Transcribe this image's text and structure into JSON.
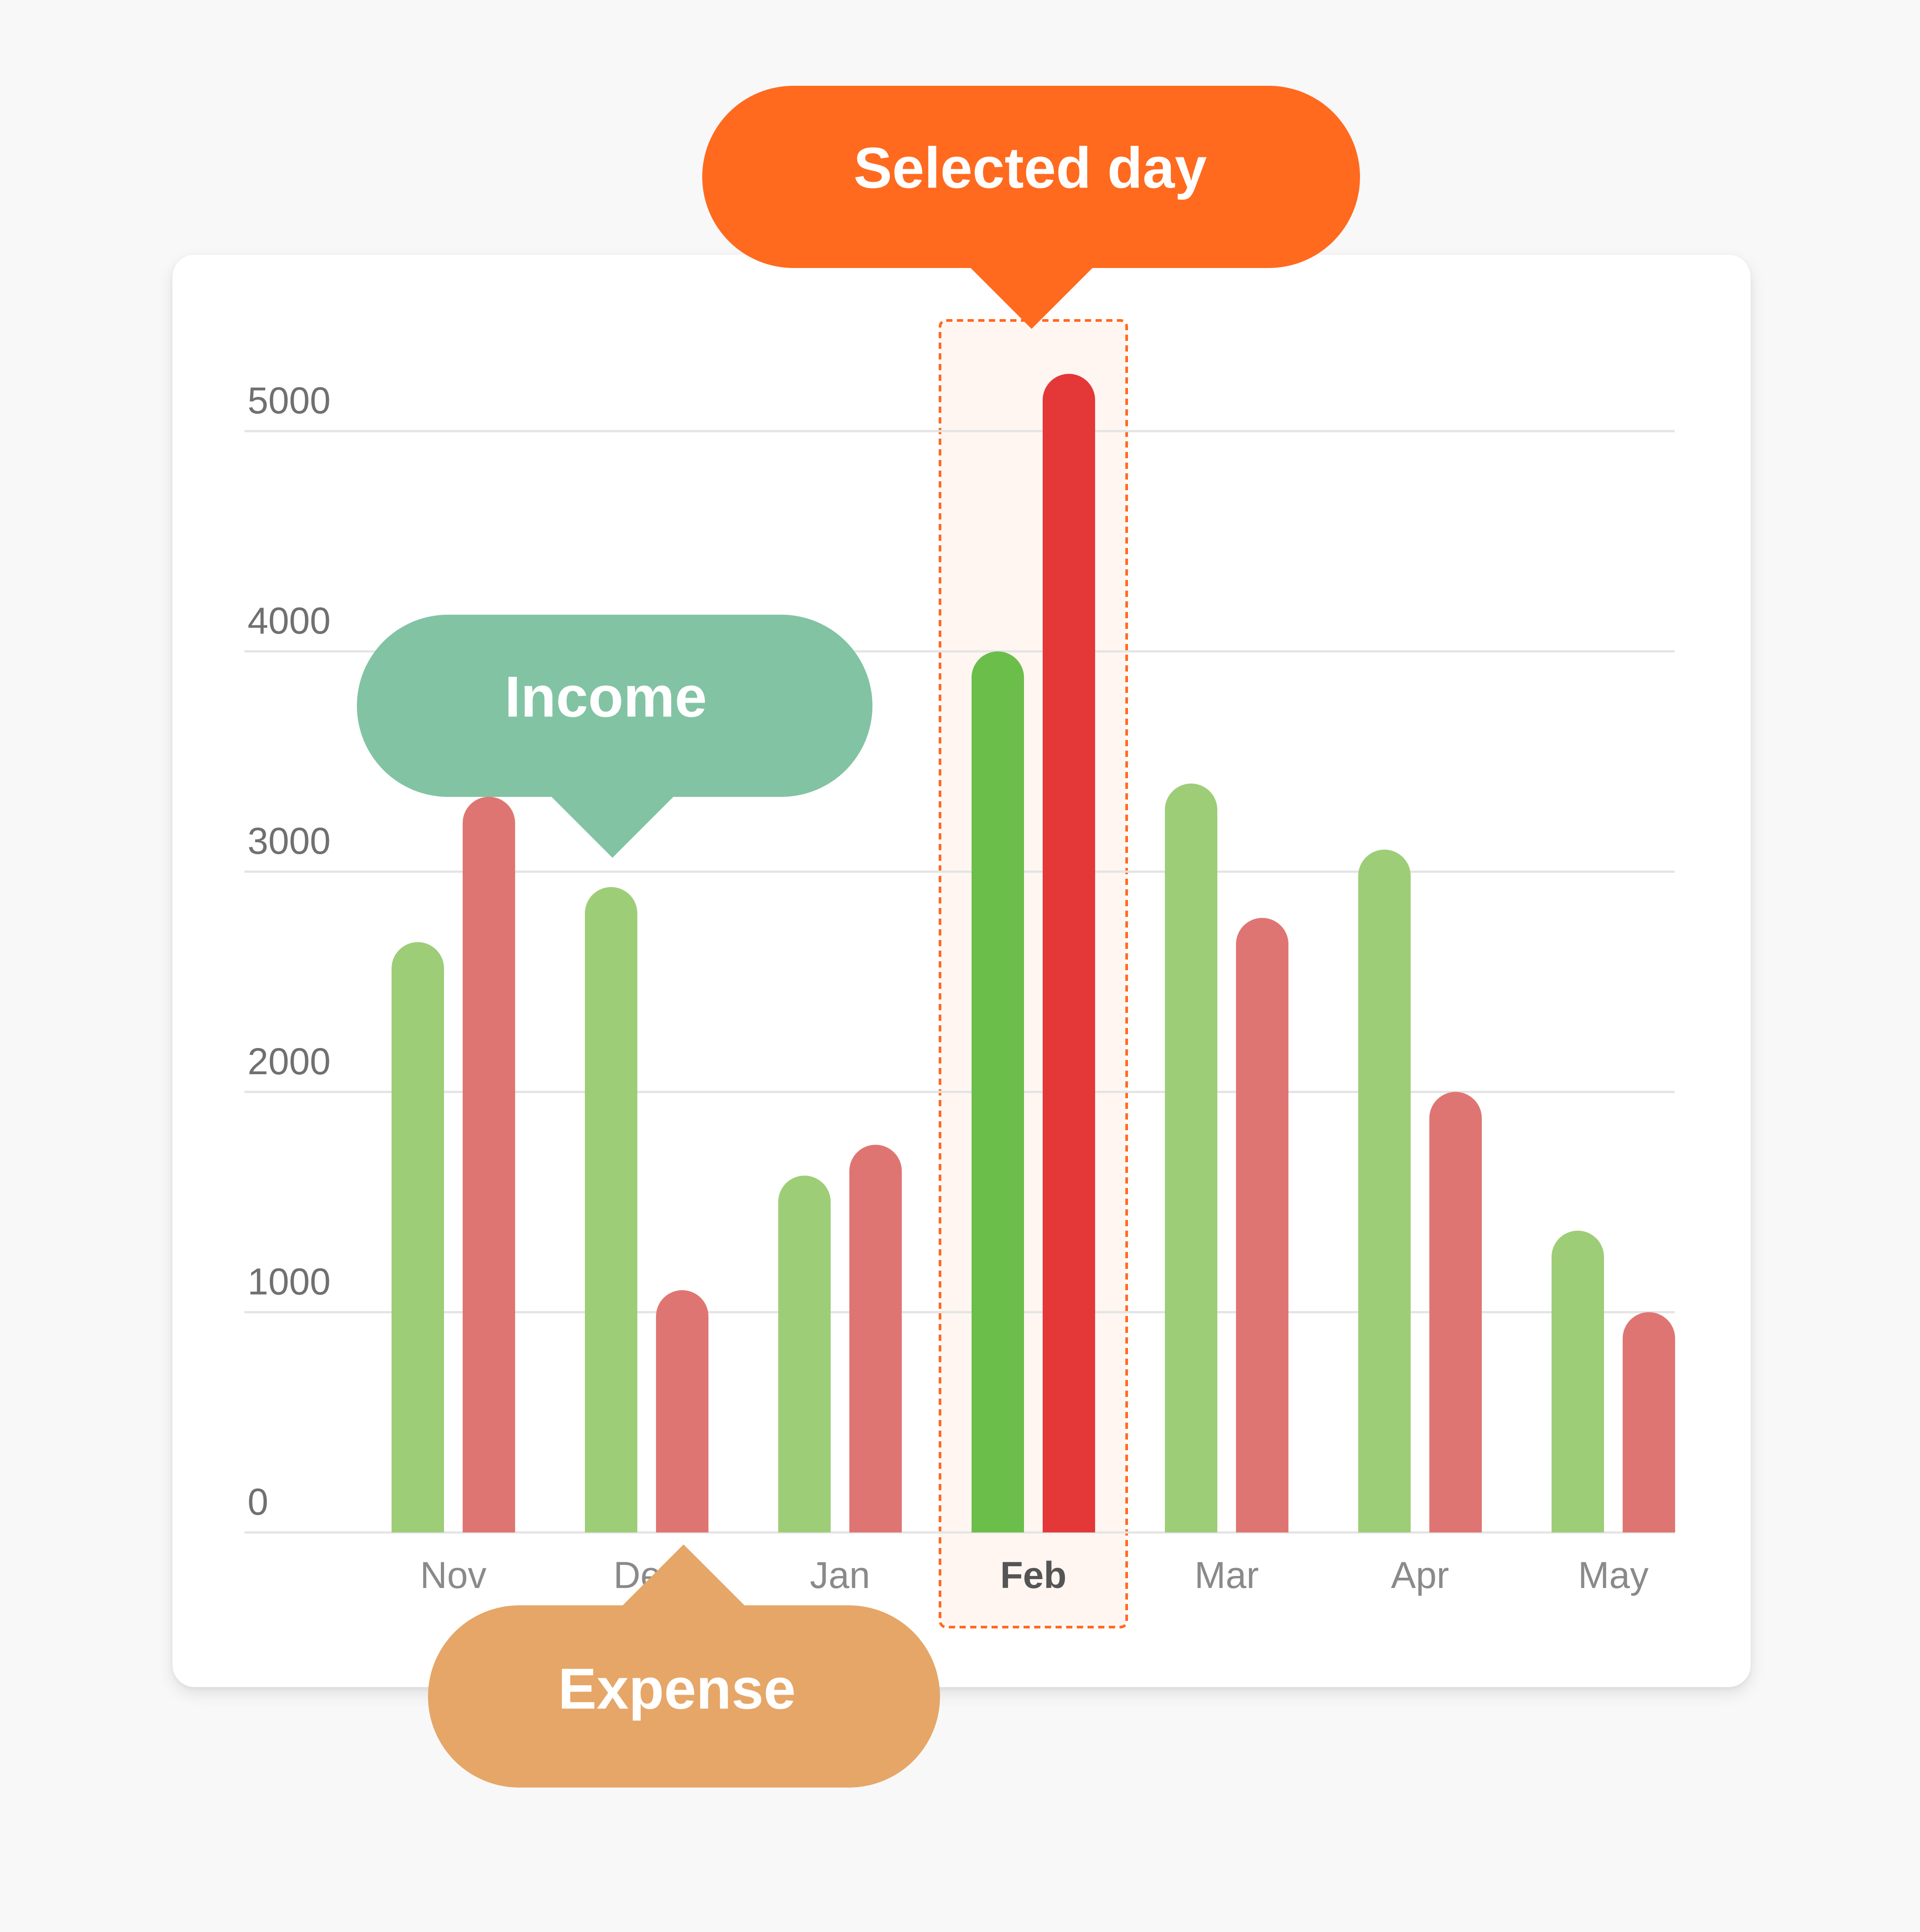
{
  "chart_data": {
    "type": "bar",
    "categories": [
      "Nov",
      "Dec",
      "Jan",
      "Feb",
      "Mar",
      "Apr",
      "May"
    ],
    "series": [
      {
        "name": "Income",
        "values": [
          2680,
          2930,
          1620,
          4000,
          3400,
          3100,
          1370
        ]
      },
      {
        "name": "Expense",
        "values": [
          3340,
          1100,
          1760,
          5260,
          2790,
          2000,
          1000
        ]
      }
    ],
    "yticks": [
      0,
      1000,
      2000,
      3000,
      4000,
      5000
    ],
    "ylim": [
      0,
      5000
    ],
    "grid": true,
    "selected_category": "Feb",
    "colors": {
      "income": "#9ecd78",
      "expense": "#df7572",
      "income_selected": "#6cbe4a",
      "expense_selected": "#e43838",
      "selected_border": "#ff6a1f",
      "selected_fill": "#fff6f2"
    }
  },
  "annotations": {
    "selected": {
      "text": "Selected day",
      "color": "#ff6a1f"
    },
    "income": {
      "text": "Income",
      "color": "#82c3a3"
    },
    "expense": {
      "text": "Expense",
      "color": "#e6a668"
    }
  }
}
